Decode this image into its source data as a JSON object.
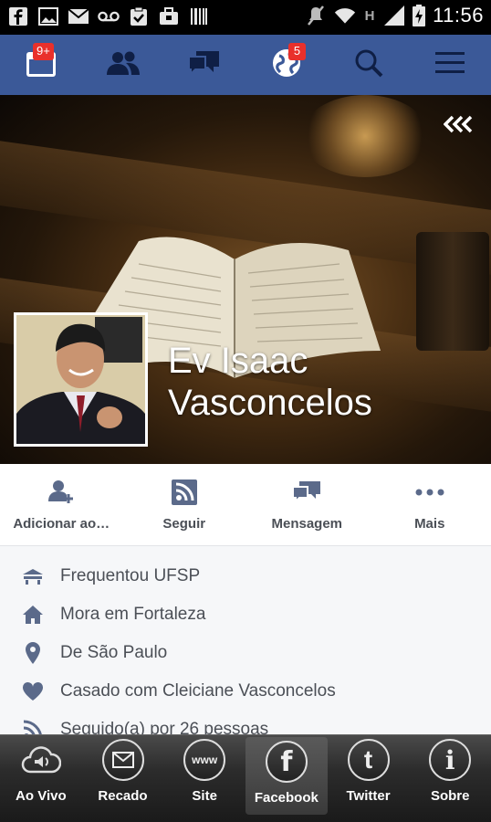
{
  "status_bar": {
    "time": "11:56",
    "left_icons": [
      "facebook-icon",
      "image-icon",
      "mail-icon",
      "voicemail-icon",
      "clipboard-check-icon",
      "briefcase-icon",
      "barcode-icon"
    ],
    "right_icons": [
      "mute-icon",
      "wifi-icon",
      "h-signal-icon",
      "cell-signal-icon",
      "battery-charging-icon"
    ],
    "network_label": "H"
  },
  "nav": {
    "items": [
      {
        "name": "news-feed",
        "icon": "news-feed-icon",
        "badge": "9+"
      },
      {
        "name": "friend-requests",
        "icon": "friends-icon",
        "badge": ""
      },
      {
        "name": "messages",
        "icon": "messages-icon",
        "badge": ""
      },
      {
        "name": "notifications",
        "icon": "globe-icon",
        "badge": "5"
      },
      {
        "name": "search",
        "icon": "search-icon",
        "badge": ""
      },
      {
        "name": "menu",
        "icon": "menu-icon",
        "badge": ""
      }
    ],
    "bar_color": "#3b5998",
    "badge_color": "#e9302b"
  },
  "profile": {
    "name": "Ev Isaac Vasconcelos",
    "collapse_glyph": "«"
  },
  "actions": [
    {
      "label": "Adicionar ao…",
      "icon": "add-friend-icon"
    },
    {
      "label": "Seguir",
      "icon": "rss-follow-icon"
    },
    {
      "label": "Mensagem",
      "icon": "message-icon"
    },
    {
      "label": "Mais",
      "icon": "more-icon"
    }
  ],
  "info": [
    {
      "text": "Frequentou UFSP",
      "icon": "education-icon"
    },
    {
      "text": "Mora em Fortaleza",
      "icon": "home-icon"
    },
    {
      "text": "De São Paulo",
      "icon": "location-pin-icon"
    },
    {
      "text": "Casado com Cleiciane Vasconcelos",
      "icon": "heart-icon"
    },
    {
      "text": "Seguido(a) por 26 pessoas",
      "icon": "rss-icon"
    }
  ],
  "tabs": [
    {
      "label": "Ao Vivo",
      "icon": "cloud-speaker-icon",
      "active": false
    },
    {
      "label": "Recado",
      "icon": "envelope-icon",
      "active": false
    },
    {
      "label": "Site",
      "icon": "www-icon",
      "glyph": "www",
      "active": false
    },
    {
      "label": "Facebook",
      "icon": "facebook-icon",
      "glyph": "f",
      "active": true
    },
    {
      "label": "Twitter",
      "icon": "twitter-icon",
      "glyph": "t",
      "active": false
    },
    {
      "label": "Sobre",
      "icon": "info-icon",
      "glyph": "i",
      "active": false
    }
  ]
}
